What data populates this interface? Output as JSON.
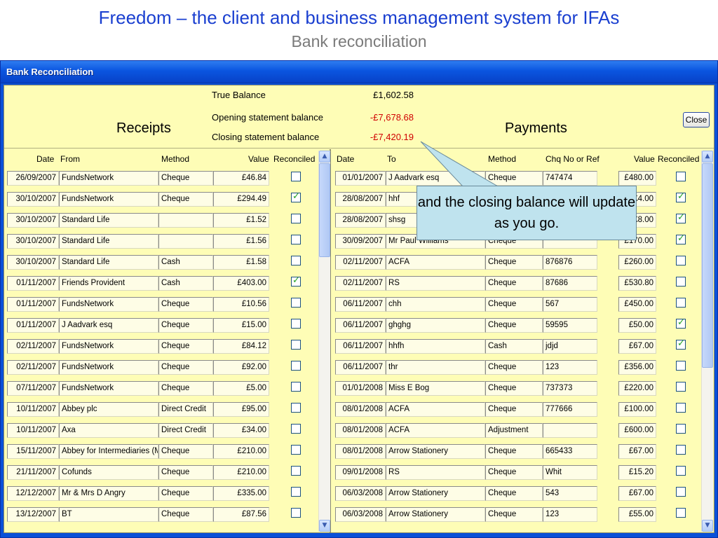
{
  "slide": {
    "title": "Freedom – the client and business management system for IFAs",
    "subtitle": "Bank reconciliation"
  },
  "window": {
    "title": "Bank Reconciliation",
    "close_label": "Close"
  },
  "balances": {
    "true_label": "True Balance",
    "true_value": "£1,602.58",
    "opening_label": "Opening statement balance",
    "opening_value": "-£7,678.68",
    "closing_label": "Closing statement balance",
    "closing_value": "-£7,420.19"
  },
  "receipts": {
    "title": "Receipts",
    "headers": {
      "date": "Date",
      "from": "From",
      "method": "Method",
      "value": "Value",
      "reconciled": "Reconciled"
    },
    "rows": [
      {
        "date": "26/09/2007",
        "from": "FundsNetwork",
        "method": "Cheque",
        "value": "£46.84",
        "reconciled": false
      },
      {
        "date": "30/10/2007",
        "from": "FundsNetwork",
        "method": "Cheque",
        "value": "£294.49",
        "reconciled": true
      },
      {
        "date": "30/10/2007",
        "from": "Standard Life",
        "method": "",
        "value": "£1.52",
        "reconciled": false
      },
      {
        "date": "30/10/2007",
        "from": "Standard Life",
        "method": "",
        "value": "£1.56",
        "reconciled": false
      },
      {
        "date": "30/10/2007",
        "from": "Standard Life",
        "method": "Cash",
        "value": "£1.58",
        "reconciled": false
      },
      {
        "date": "01/11/2007",
        "from": "Friends Provident",
        "method": "Cash",
        "value": "£403.00",
        "reconciled": true
      },
      {
        "date": "01/11/2007",
        "from": "FundsNetwork",
        "method": "Cheque",
        "value": "£10.56",
        "reconciled": false
      },
      {
        "date": "01/11/2007",
        "from": "J Aadvark esq",
        "method": "Cheque",
        "value": "£15.00",
        "reconciled": false
      },
      {
        "date": "02/11/2007",
        "from": "FundsNetwork",
        "method": "Cheque",
        "value": "£84.12",
        "reconciled": false
      },
      {
        "date": "02/11/2007",
        "from": "FundsNetwork",
        "method": "Cheque",
        "value": "£92.00",
        "reconciled": false
      },
      {
        "date": "07/11/2007",
        "from": "FundsNetwork",
        "method": "Cheque",
        "value": "£5.00",
        "reconciled": false
      },
      {
        "date": "10/11/2007",
        "from": "Abbey plc",
        "method": "Direct Credit",
        "value": "£95.00",
        "reconciled": false
      },
      {
        "date": "10/11/2007",
        "from": "Axa",
        "method": "Direct Credit",
        "value": "£34.00",
        "reconciled": false
      },
      {
        "date": "15/11/2007",
        "from": "Abbey for Intermediaries (Mt",
        "method": "Cheque",
        "value": "£210.00",
        "reconciled": false
      },
      {
        "date": "21/11/2007",
        "from": "Cofunds",
        "method": "Cheque",
        "value": "£210.00",
        "reconciled": false
      },
      {
        "date": "12/12/2007",
        "from": "Mr & Mrs D Angry",
        "method": "Cheque",
        "value": "£335.00",
        "reconciled": false
      },
      {
        "date": "13/12/2007",
        "from": "BT",
        "method": "Cheque",
        "value": "£87.56",
        "reconciled": false
      }
    ]
  },
  "payments": {
    "title": "Payments",
    "headers": {
      "date": "Date",
      "to": "To",
      "method": "Method",
      "ref": "Chq No or Ref",
      "value": "Value",
      "reconciled": "Reconciled"
    },
    "rows": [
      {
        "date": "01/01/2007",
        "to": "J Aadvark esq",
        "method": "Cheque",
        "ref": "747474",
        "value": "£480.00",
        "reconciled": false
      },
      {
        "date": "28/08/2007",
        "to": "hhf",
        "method": "",
        "ref": "",
        "value": "£4.00",
        "reconciled": true
      },
      {
        "date": "28/08/2007",
        "to": "shsg",
        "method": "",
        "ref": "",
        "value": "£8.00",
        "reconciled": true
      },
      {
        "date": "30/09/2007",
        "to": "Mr Paul Williams",
        "method": "Cheque",
        "ref": "",
        "value": "£170.00",
        "reconciled": true
      },
      {
        "date": "02/11/2007",
        "to": "ACFA",
        "method": "Cheque",
        "ref": "876876",
        "value": "£260.00",
        "reconciled": false
      },
      {
        "date": "02/11/2007",
        "to": "RS",
        "method": "Cheque",
        "ref": "87686",
        "value": "£530.80",
        "reconciled": false
      },
      {
        "date": "06/11/2007",
        "to": "chh",
        "method": "Cheque",
        "ref": "567",
        "value": "£450.00",
        "reconciled": false
      },
      {
        "date": "06/11/2007",
        "to": "ghghg",
        "method": "Cheque",
        "ref": "59595",
        "value": "£50.00",
        "reconciled": true
      },
      {
        "date": "06/11/2007",
        "to": "hhfh",
        "method": "Cash",
        "ref": "jdjd",
        "value": "£67.00",
        "reconciled": true
      },
      {
        "date": "06/11/2007",
        "to": "thr",
        "method": "Cheque",
        "ref": "123",
        "value": "£356.00",
        "reconciled": false
      },
      {
        "date": "01/01/2008",
        "to": "Miss E Bog",
        "method": "Cheque",
        "ref": "737373",
        "value": "£220.00",
        "reconciled": false
      },
      {
        "date": "08/01/2008",
        "to": "ACFA",
        "method": "Cheque",
        "ref": "777666",
        "value": "£100.00",
        "reconciled": false
      },
      {
        "date": "08/01/2008",
        "to": "ACFA",
        "method": "Adjustment",
        "ref": "",
        "value": "£600.00",
        "reconciled": false
      },
      {
        "date": "08/01/2008",
        "to": "Arrow Stationery",
        "method": "Cheque",
        "ref": "665433",
        "value": "£67.00",
        "reconciled": false
      },
      {
        "date": "09/01/2008",
        "to": "RS",
        "method": "Cheque",
        "ref": "Whit",
        "value": "£15.20",
        "reconciled": false
      },
      {
        "date": "06/03/2008",
        "to": "Arrow Stationery",
        "method": "Cheque",
        "ref": "543",
        "value": "£67.00",
        "reconciled": false
      },
      {
        "date": "06/03/2008",
        "to": "Arrow Stationery",
        "method": "Cheque",
        "ref": "123",
        "value": "£55.00",
        "reconciled": false
      }
    ]
  },
  "callout": {
    "text": "and the closing balance will update as you go."
  },
  "icons": {
    "scroll_up": "scroll-up-arrow-icon",
    "scroll_down": "scroll-down-arrow-icon",
    "check": "checkmark-icon"
  },
  "colors": {
    "title_blue": "#1a3fd0",
    "negative_red": "#d00000",
    "panel_yellow": "#fefdb6",
    "titlebar_blue": "#0a55e0",
    "callout_blue": "#bfe3ee"
  }
}
